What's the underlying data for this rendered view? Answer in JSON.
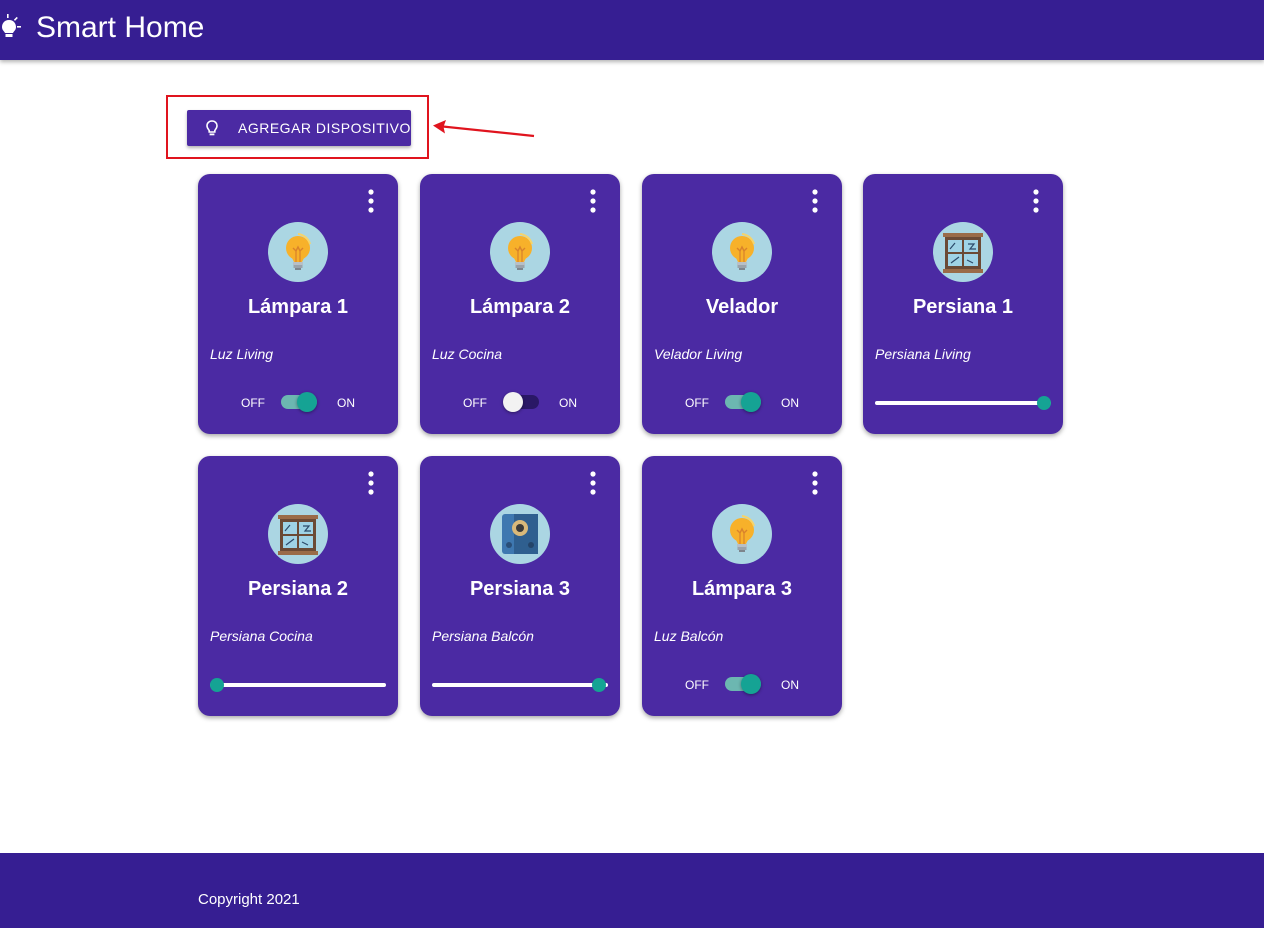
{
  "header": {
    "title": "Smart Home",
    "icon": "lightbulb-icon"
  },
  "toolbar": {
    "add_label": "AGREGAR DISPOSITIVO",
    "add_icon": "lightbulb-outline-icon"
  },
  "devices": [
    {
      "name": "Lámpara 1",
      "description": "Luz Living",
      "type": "lamp",
      "control": "switch",
      "state": true,
      "off_label": "OFF",
      "on_label": "ON"
    },
    {
      "name": "Lámpara 2",
      "description": "Luz Cocina",
      "type": "lamp",
      "control": "switch",
      "state": false,
      "off_label": "OFF",
      "on_label": "ON"
    },
    {
      "name": "Velador",
      "description": "Velador Living",
      "type": "lamp",
      "control": "switch",
      "state": true,
      "off_label": "OFF",
      "on_label": "ON"
    },
    {
      "name": "Persiana 1",
      "description": "Persiana Living",
      "type": "blind",
      "control": "slider",
      "level": 0.96
    },
    {
      "name": "Persiana 2",
      "description": "Persiana Cocina",
      "type": "blind",
      "control": "slider",
      "level": 0.04
    },
    {
      "name": "Persiana 3",
      "description": "Persiana Balcón",
      "type": "speaker",
      "control": "slider",
      "level": 0.95
    },
    {
      "name": "Lámpara 3",
      "description": "Luz Balcón",
      "type": "lamp",
      "control": "switch",
      "state": true,
      "off_label": "OFF",
      "on_label": "ON"
    }
  ],
  "footer": {
    "copyright": "Copyright 2021"
  },
  "colors": {
    "header": "#361e92",
    "card": "#4b2aa3",
    "accent": "#15a394",
    "highlight": "#e0141e"
  }
}
